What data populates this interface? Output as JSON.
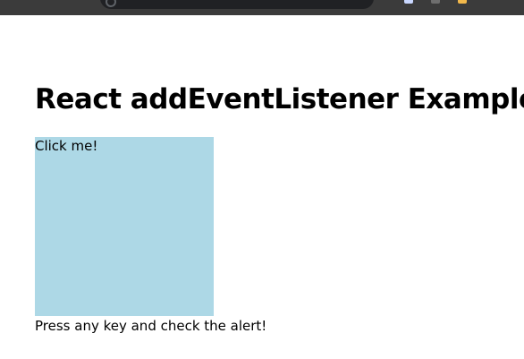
{
  "browser": {
    "toolbar_icons": [
      "document-icon",
      "extension-icon",
      "star-icon"
    ]
  },
  "main": {
    "title": "React addEventListener Example",
    "click_box": {
      "label": "Click me!",
      "background_color": "#add8e6"
    },
    "instructions": "Press any key and check the alert!"
  }
}
